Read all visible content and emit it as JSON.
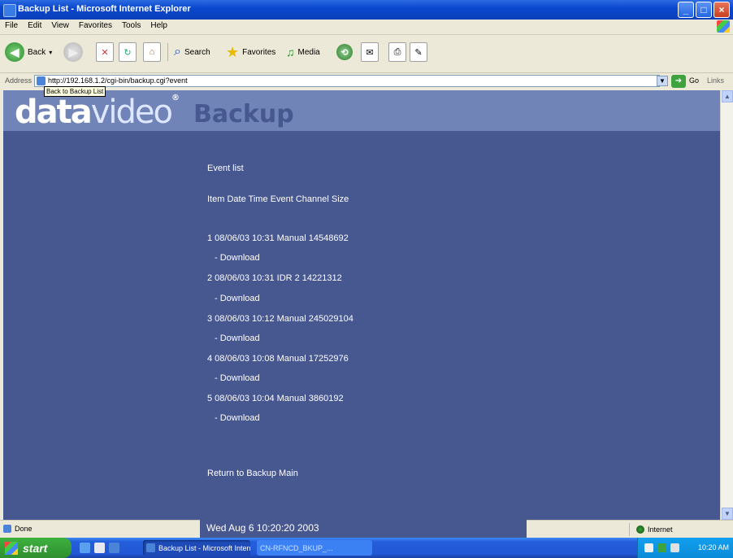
{
  "window": {
    "title": "Backup List - Microsoft Internet Explorer",
    "controls": {
      "minimize": "_",
      "maximize": "□",
      "close": "×"
    }
  },
  "menu": [
    "File",
    "Edit",
    "View",
    "Favorites",
    "Tools",
    "Help"
  ],
  "toolbar": {
    "back_label": "Back",
    "search_label": "Search",
    "favorites_label": "Favorites",
    "media_label": "Media",
    "icons": [
      "back-arrow",
      "forward-arrow",
      "stop",
      "refresh",
      "home",
      "search",
      "favorites-star",
      "media",
      "history",
      "mail",
      "print",
      "edit"
    ]
  },
  "address": {
    "label": "Address",
    "url": "http://192.168.1.2/cgi-bin/backup.cgi?event",
    "tooltip": "Back to Backup List",
    "go_label": "Go",
    "links_label": "Links"
  },
  "banner": {
    "logo_main": "data",
    "logo_rest": "video",
    "logo_mark": "®",
    "heading": "Backup"
  },
  "event_list": {
    "title": "Event list",
    "header": "Item Date Time Event Channel Size",
    "entries": [
      {
        "text": "1 08/06/03 10:31 Manual 14548692",
        "download": "- Download"
      },
      {
        "text": "2 08/06/03 10:31 IDR 2 14221312",
        "download": "- Download"
      },
      {
        "text": "3 08/06/03 10:12 Manual 245029104",
        "download": "- Download"
      },
      {
        "text": "4 08/06/03 10:08 Manual 17252976",
        "download": "- Download"
      },
      {
        "text": "5 08/06/03 10:04 Manual 3860192",
        "download": "- Download"
      }
    ],
    "return_link": "Return to Backup Main",
    "datetime": "Wed Aug 6 10:20:20 2003"
  },
  "status": {
    "left": "Done",
    "zone": "Internet"
  },
  "taskbar": {
    "start": "start",
    "tasks": [
      "Backup List - Microsoft Internet Explorer",
      "CN-RFNCD_BKUP_..."
    ],
    "clock": "10:20 AM"
  },
  "colors": {
    "content_bg": "#475790",
    "banner_bg": "#7084B8",
    "text": "#FFFFFF"
  }
}
